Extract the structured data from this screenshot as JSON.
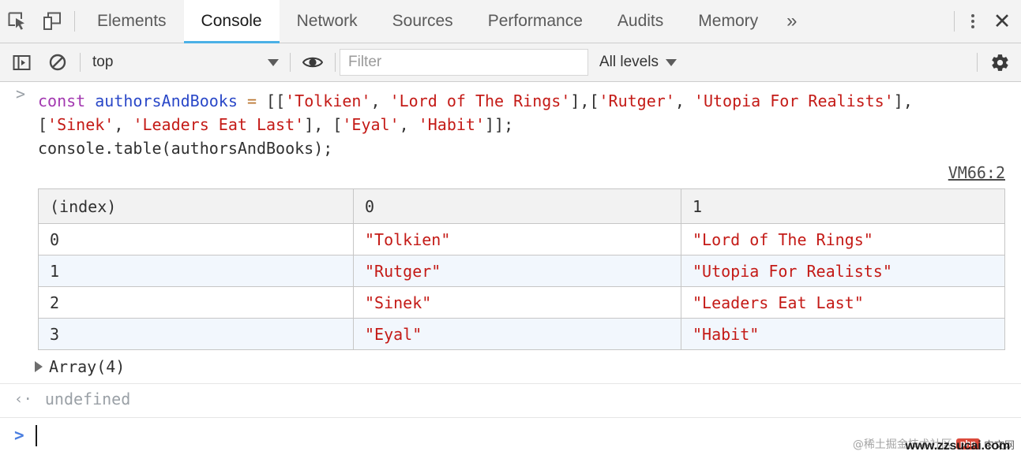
{
  "tabbar": {
    "icons": [
      {
        "name": "inspect-element-icon",
        "label": "Inspect element"
      },
      {
        "name": "device-toolbar-icon",
        "label": "Toggle device toolbar"
      }
    ],
    "tabs": [
      {
        "label": "Elements",
        "active": false
      },
      {
        "label": "Console",
        "active": true
      },
      {
        "label": "Network",
        "active": false
      },
      {
        "label": "Sources",
        "active": false
      },
      {
        "label": "Performance",
        "active": false
      },
      {
        "label": "Audits",
        "active": false
      },
      {
        "label": "Memory",
        "active": false
      }
    ],
    "more_label": "»",
    "menu_label": "Customize and control DevTools",
    "close_label": "✕",
    "active_underline_color": "#4bb0e6"
  },
  "filterbar": {
    "sidebar_toggle": "console-sidebar-icon",
    "clear_console": "clear-console-icon",
    "context": "top",
    "eye_icon": "live-expression-icon",
    "filter_placeholder": "Filter",
    "filter_value": "",
    "levels": "All levels",
    "settings_icon": "gear-icon"
  },
  "console": {
    "input": {
      "chevron": ">",
      "tokens": [
        {
          "t": "const",
          "c": "kw"
        },
        {
          "t": " ",
          "c": "plain"
        },
        {
          "t": "authorsAndBooks",
          "c": "varn"
        },
        {
          "t": " ",
          "c": "plain"
        },
        {
          "t": "=",
          "c": "op"
        },
        {
          "t": " [[",
          "c": "punc"
        },
        {
          "t": "'Tolkien'",
          "c": "str"
        },
        {
          "t": ", ",
          "c": "punc"
        },
        {
          "t": "'Lord of The Rings'",
          "c": "str"
        },
        {
          "t": "],[",
          "c": "punc"
        },
        {
          "t": "'Rutger'",
          "c": "str"
        },
        {
          "t": ", ",
          "c": "punc"
        },
        {
          "t": "'Utopia For Realists'",
          "c": "str"
        },
        {
          "t": "],\n[",
          "c": "punc"
        },
        {
          "t": "'Sinek'",
          "c": "str"
        },
        {
          "t": ", ",
          "c": "punc"
        },
        {
          "t": "'Leaders Eat Last'",
          "c": "str"
        },
        {
          "t": "], [",
          "c": "punc"
        },
        {
          "t": "'Eyal'",
          "c": "str"
        },
        {
          "t": ", ",
          "c": "punc"
        },
        {
          "t": "'Habit'",
          "c": "str"
        },
        {
          "t": "]];\n",
          "c": "punc"
        },
        {
          "t": "console.table(authorsAndBooks);",
          "c": "plain"
        }
      ]
    },
    "source_link": "VM66:2",
    "array_summary": "Array(4)",
    "return_arrow": "‹·",
    "return_value": "undefined",
    "prompt_chevron": ">"
  },
  "table": {
    "headers": [
      "(index)",
      "0",
      "1"
    ],
    "rows": [
      {
        "index": "0",
        "c0": "\"Tolkien\"",
        "c1": "\"Lord of The Rings\""
      },
      {
        "index": "1",
        "c0": "\"Rutger\"",
        "c1": "\"Utopia For Realists\""
      },
      {
        "index": "2",
        "c0": "\"Sinek\"",
        "c1": "\"Leaders Eat Last\""
      },
      {
        "index": "3",
        "c0": "\"Eyal\"",
        "c1": "\"Habit\""
      }
    ]
  },
  "watermark": {
    "handle": "@稀土掘金技术社区",
    "php_badge": "php",
    "cn_text": "中文网",
    "url": "www.zzsucai.com"
  }
}
